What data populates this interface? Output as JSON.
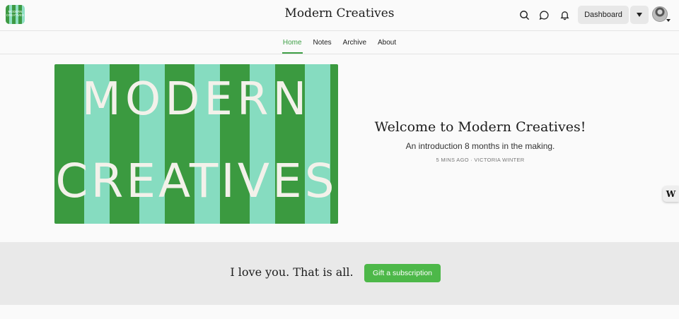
{
  "header": {
    "logo_text": "MODERN CREATIVES",
    "title": "Modern Creatives",
    "search_icon": "search-icon",
    "chat_icon": "chat-bubble-icon",
    "bell_icon": "bell-icon",
    "dashboard_label": "Dashboard"
  },
  "nav": {
    "tabs": [
      {
        "label": "Home",
        "active": true
      },
      {
        "label": "Notes",
        "active": false
      },
      {
        "label": "Archive",
        "active": false
      },
      {
        "label": "About",
        "active": false
      }
    ]
  },
  "hero": {
    "image_line1": "MODERN",
    "image_line2": "CREATIVES",
    "title": "Welcome to Modern Creatives!",
    "subtitle": "An introduction 8 months in the making.",
    "meta": "5 MINS AGO · VICTORIA WINTER"
  },
  "side_tab": {
    "label": "W"
  },
  "gift": {
    "text": "I love you. That is all.",
    "button_label": "Gift a subscription"
  },
  "colors": {
    "accent": "#3f9f46",
    "button_green": "#4db849",
    "hero_dark_green": "#3b9a40",
    "hero_mint": "#86dcc0"
  }
}
